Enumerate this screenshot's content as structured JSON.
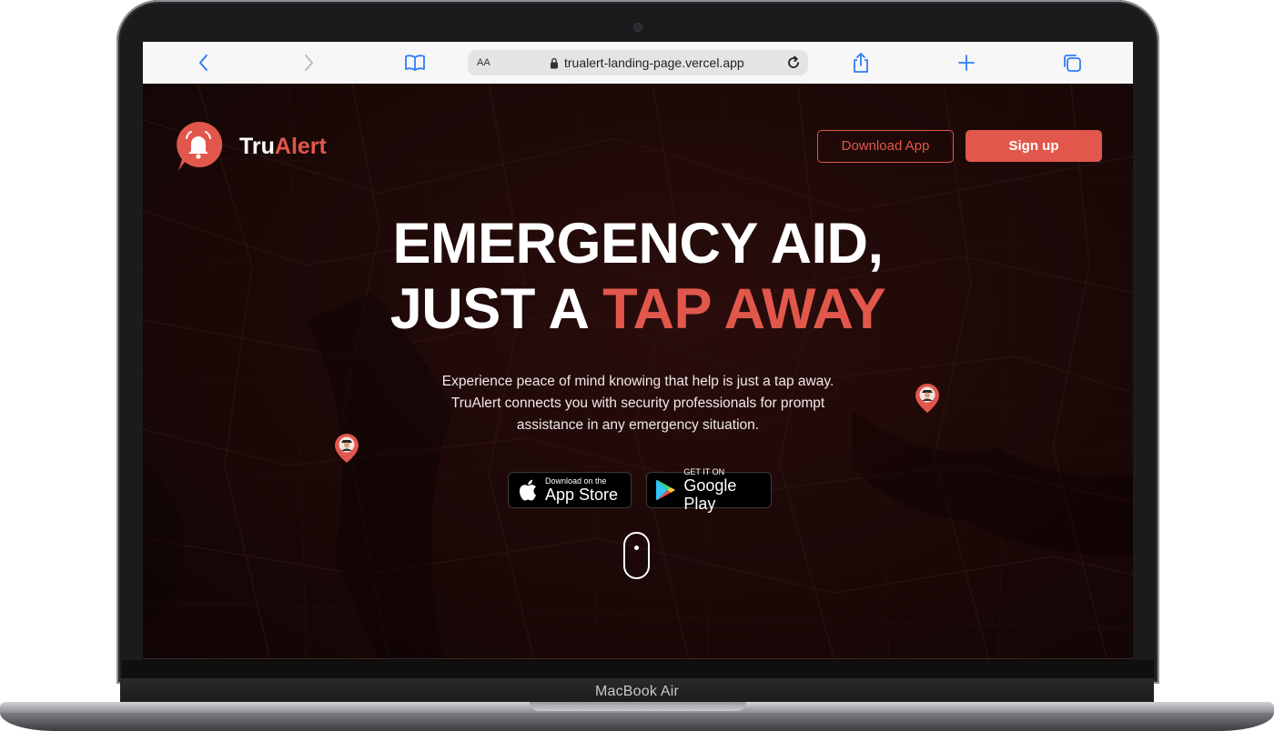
{
  "device": {
    "label": "MacBook Air"
  },
  "browser": {
    "text_size_label": "AA",
    "url": "trualert-landing-page.vercel.app"
  },
  "page": {
    "brand": {
      "name_part1": "Tru",
      "name_part2": "Alert"
    },
    "nav": {
      "download_label": "Download App",
      "signup_label": "Sign up"
    },
    "hero": {
      "headline_line1": "EMERGENCY AID,",
      "headline_line2_plain": "JUST A ",
      "headline_line2_accent": "TAP AWAY",
      "subtext_line1": "Experience peace of mind knowing that help is just a tap away.",
      "subtext_line2": "TruAlert connects you with security professionals for prompt",
      "subtext_line3": "assistance in any emergency situation."
    },
    "stores": {
      "app_store_small": "Download on the",
      "app_store_big": "App Store",
      "google_play_small": "GET IT ON",
      "google_play_big": "Google Play"
    }
  },
  "colors": {
    "accent": "#e2574c",
    "background": "#1b0807"
  }
}
